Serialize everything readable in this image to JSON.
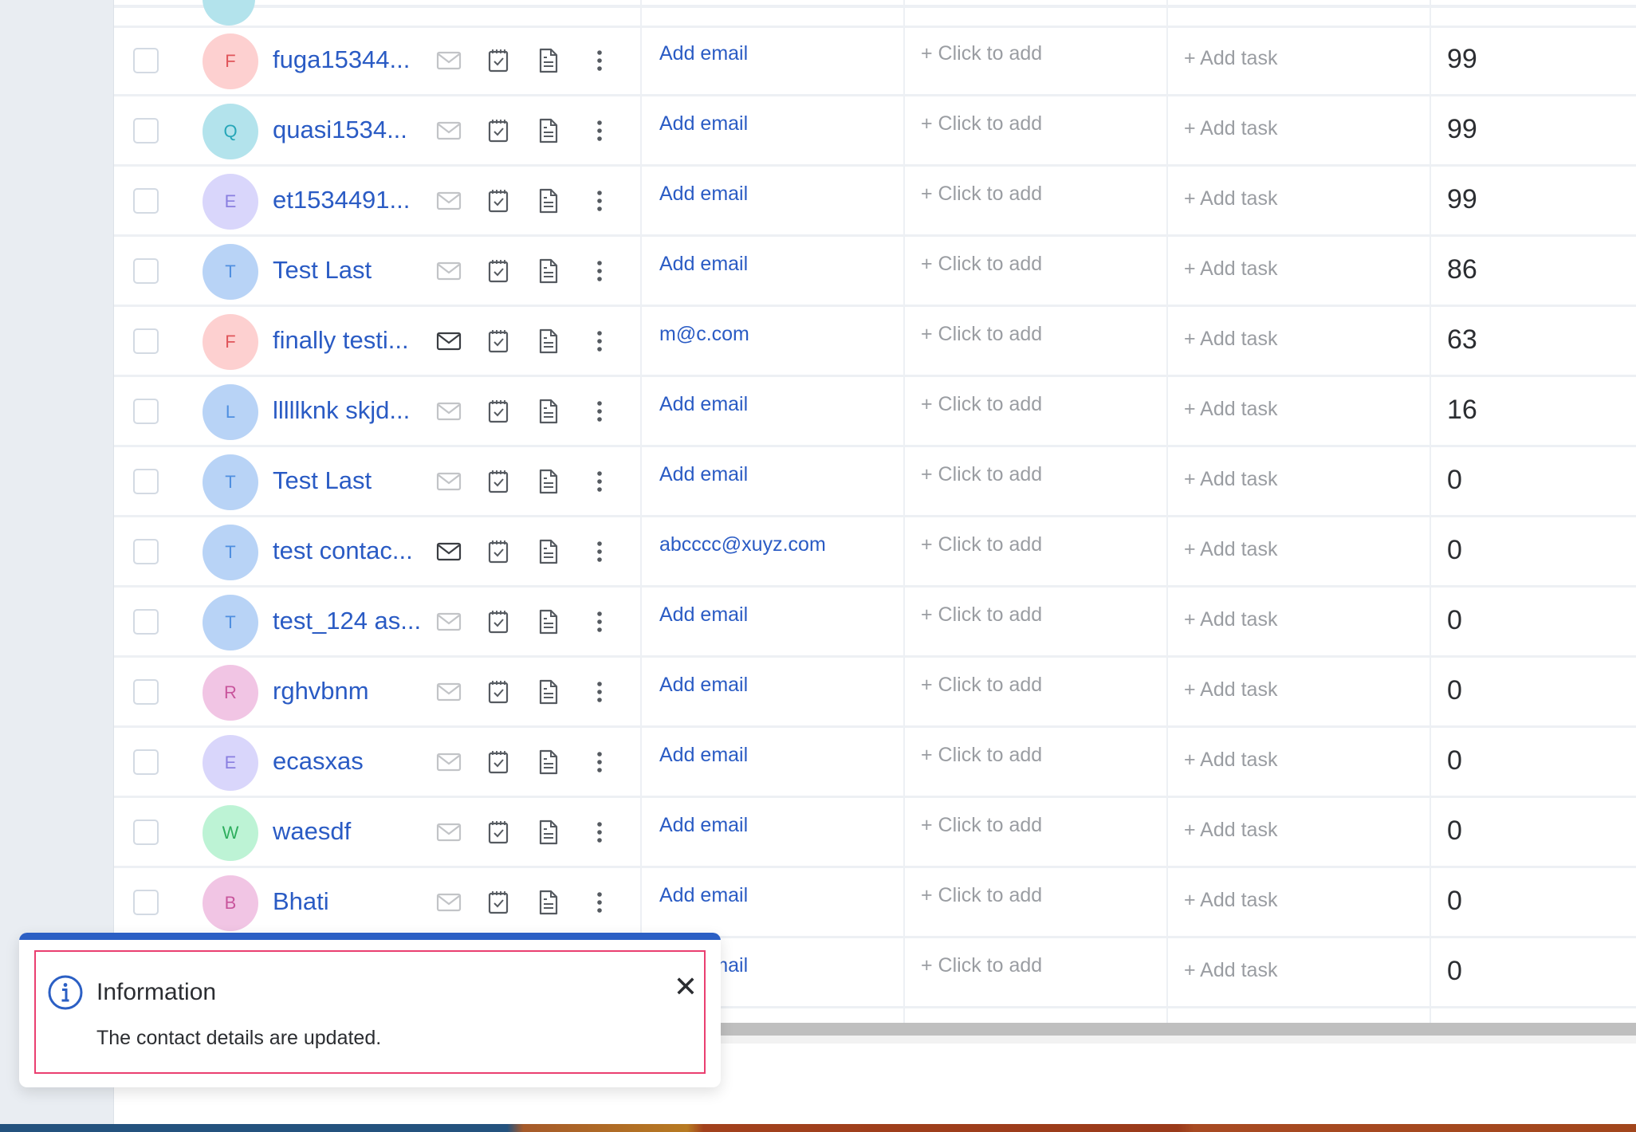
{
  "colors": {
    "link": "#2a5bc4",
    "muted": "#9a9da2",
    "toast_accent": "#2b5fc4",
    "focus_ring": "#ea3f70"
  },
  "table": {
    "placeholders": {
      "add_email": "Add email",
      "click_to_add": "+ Click to add",
      "add_task": "+ Add task"
    },
    "row_icons": [
      "mail-icon",
      "task-icon",
      "note-icon",
      "more-options-icon"
    ],
    "rows": [
      {
        "initial": "F",
        "name": "fuga15344...",
        "email": "Add email",
        "has_email": false,
        "field": "+ Click to add",
        "task": "+ Add task",
        "score": "99",
        "avatar_bg": "#fdd0d0",
        "avatar_fg": "#e0555a"
      },
      {
        "initial": "Q",
        "name": "quasi1534...",
        "email": "Add email",
        "has_email": false,
        "field": "+ Click to add",
        "task": "+ Add task",
        "score": "99",
        "avatar_bg": "#b3e3ec",
        "avatar_fg": "#26a6b8"
      },
      {
        "initial": "E",
        "name": "et1534491...",
        "email": "Add email",
        "has_email": false,
        "field": "+ Click to add",
        "task": "+ Add task",
        "score": "99",
        "avatar_bg": "#d9d6fb",
        "avatar_fg": "#8a7fe0"
      },
      {
        "initial": "T",
        "name": "Test Last",
        "email": "Add email",
        "has_email": false,
        "field": "+ Click to add",
        "task": "+ Add task",
        "score": "86",
        "avatar_bg": "#b8d3f6",
        "avatar_fg": "#4f8fe0"
      },
      {
        "initial": "F",
        "name": "finally testi...",
        "email": "m@c.com",
        "has_email": true,
        "field": "+ Click to add",
        "task": "+ Add task",
        "score": "63",
        "avatar_bg": "#fdd0d0",
        "avatar_fg": "#e0555a"
      },
      {
        "initial": "L",
        "name": "lllllknk skjd...",
        "email": "Add email",
        "has_email": false,
        "field": "+ Click to add",
        "task": "+ Add task",
        "score": "16",
        "avatar_bg": "#b8d3f6",
        "avatar_fg": "#4f8fe0"
      },
      {
        "initial": "T",
        "name": "Test Last",
        "email": "Add email",
        "has_email": false,
        "field": "+ Click to add",
        "task": "+ Add task",
        "score": "0",
        "avatar_bg": "#b8d3f6",
        "avatar_fg": "#4f8fe0"
      },
      {
        "initial": "T",
        "name": "test contac...",
        "email": "abcccc@xuyz.com",
        "has_email": true,
        "field": "+ Click to add",
        "task": "+ Add task",
        "score": "0",
        "avatar_bg": "#b8d3f6",
        "avatar_fg": "#4f8fe0"
      },
      {
        "initial": "T",
        "name": "test_124 as...",
        "email": "Add email",
        "has_email": false,
        "field": "+ Click to add",
        "task": "+ Add task",
        "score": "0",
        "avatar_bg": "#b8d3f6",
        "avatar_fg": "#4f8fe0"
      },
      {
        "initial": "R",
        "name": "rghvbnm",
        "email": "Add email",
        "has_email": false,
        "field": "+ Click to add",
        "task": "+ Add task",
        "score": "0",
        "avatar_bg": "#f1c5e4",
        "avatar_fg": "#c8559c"
      },
      {
        "initial": "E",
        "name": "ecasxas",
        "email": "Add email",
        "has_email": false,
        "field": "+ Click to add",
        "task": "+ Add task",
        "score": "0",
        "avatar_bg": "#d9d6fb",
        "avatar_fg": "#8a7fe0"
      },
      {
        "initial": "W",
        "name": "waesdf",
        "email": "Add email",
        "has_email": false,
        "field": "+ Click to add",
        "task": "+ Add task",
        "score": "0",
        "avatar_bg": "#bdf3d5",
        "avatar_fg": "#2eae5e"
      },
      {
        "initial": "B",
        "name": "Bhati",
        "email": "Add email",
        "has_email": false,
        "field": "+ Click to add",
        "task": "+ Add task",
        "score": "0",
        "avatar_bg": "#f1c5e4",
        "avatar_fg": "#c8559c"
      },
      {
        "initial": "",
        "name": "",
        "email": "Add email",
        "has_email": false,
        "field": "+ Click to add",
        "task": "+ Add task",
        "score": "0",
        "avatar_bg": "",
        "avatar_fg": ""
      }
    ]
  },
  "toast": {
    "title": "Information",
    "message": "The contact details are updated.",
    "close_label": "✕",
    "icon": "info-icon"
  }
}
